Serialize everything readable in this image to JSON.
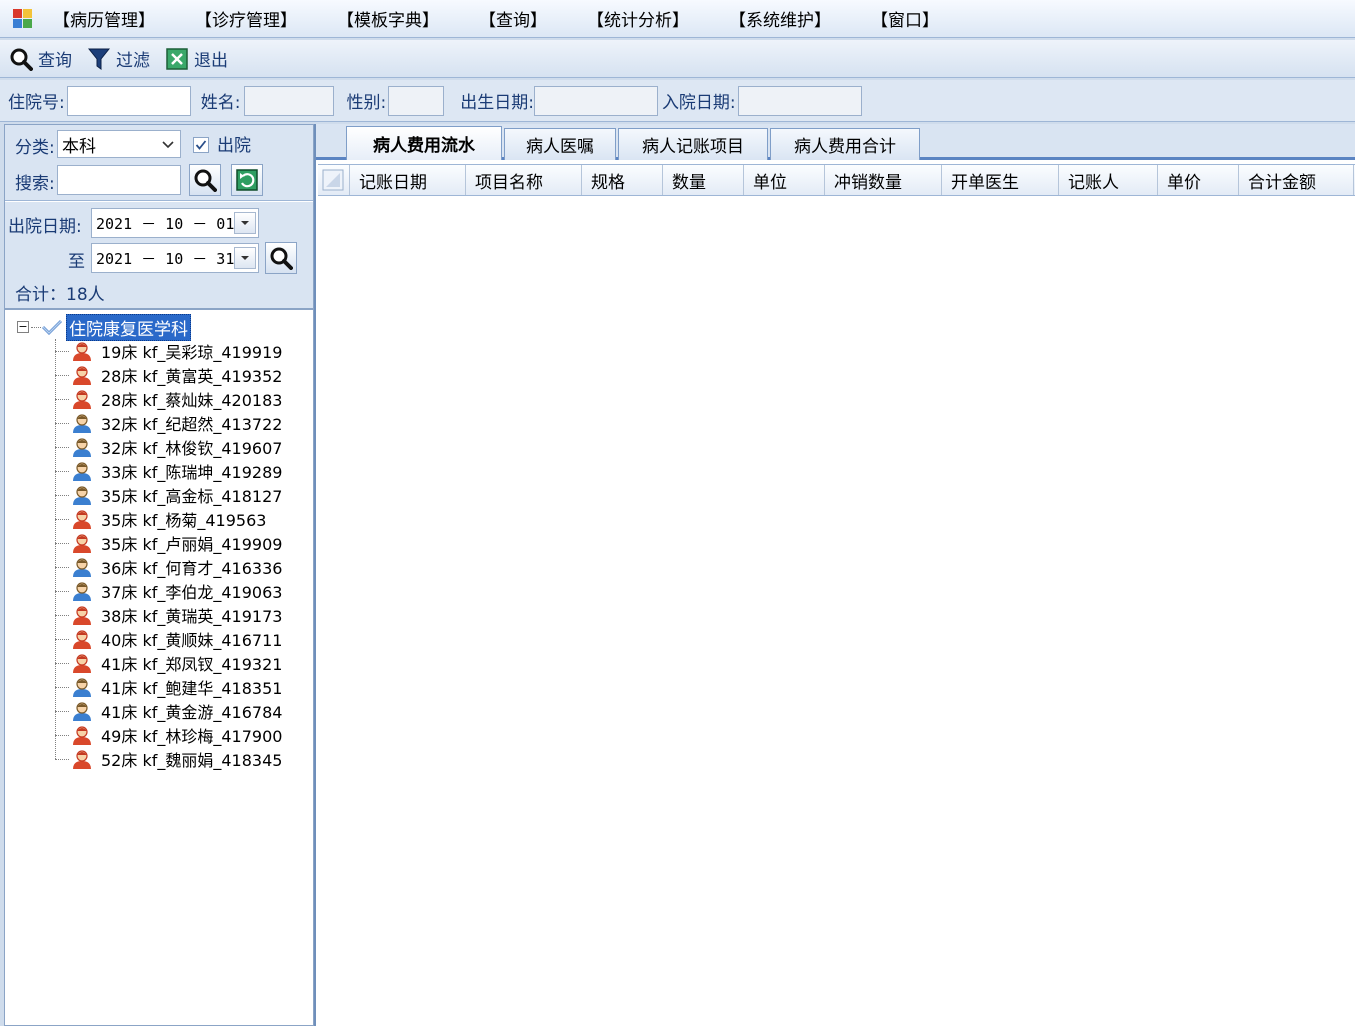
{
  "menu": {
    "items": [
      "【病历管理】",
      "【诊疗管理】",
      "【模板字典】",
      "【查询】",
      "【统计分析】",
      "【系统维护】",
      "【窗口】"
    ]
  },
  "toolbar": {
    "query_label": "查询",
    "filter_label": "过滤",
    "exit_label": "退出"
  },
  "search": {
    "admission_no_label": "住院号:",
    "name_label": "姓名:",
    "gender_label": "性别:",
    "birthdate_label": "出生日期:",
    "admit_date_label": "入院日期:"
  },
  "filter": {
    "category_label": "分类:",
    "category_value": "本科",
    "discharged_label": "出院",
    "discharged_checked": true,
    "search_label": "搜索:"
  },
  "dates": {
    "discharge_label": "出院日期:",
    "from": "2021 － 10 － 01",
    "to_label": "至",
    "to": "2021 － 10 － 31",
    "total": "合计：18人"
  },
  "tree": {
    "root": "住院康复医学科",
    "patients": [
      {
        "label": "19床 kf_吴彩琼_419919",
        "gender": "F"
      },
      {
        "label": "28床 kf_黄富英_419352",
        "gender": "F"
      },
      {
        "label": "28床 kf_蔡灿妹_420183",
        "gender": "F"
      },
      {
        "label": "32床 kf_纪超然_413722",
        "gender": "M"
      },
      {
        "label": "32床 kf_林俊钦_419607",
        "gender": "M"
      },
      {
        "label": "33床 kf_陈瑞坤_419289",
        "gender": "M"
      },
      {
        "label": "35床 kf_高金标_418127",
        "gender": "M"
      },
      {
        "label": "35床 kf_杨菊_419563",
        "gender": "F"
      },
      {
        "label": "35床 kf_卢丽娟_419909",
        "gender": "F"
      },
      {
        "label": "36床 kf_何育才_416336",
        "gender": "M"
      },
      {
        "label": "37床 kf_李伯龙_419063",
        "gender": "M"
      },
      {
        "label": "38床 kf_黄瑞英_419173",
        "gender": "F"
      },
      {
        "label": "40床 kf_黄顺妹_416711",
        "gender": "F"
      },
      {
        "label": "41床 kf_郑凤钗_419321",
        "gender": "F"
      },
      {
        "label": "41床 kf_鲍建华_418351",
        "gender": "M"
      },
      {
        "label": "41床 kf_黄金游_416784",
        "gender": "M"
      },
      {
        "label": "49床 kf_林珍梅_417900",
        "gender": "F"
      },
      {
        "label": "52床 kf_魏丽娟_418345",
        "gender": "F"
      }
    ]
  },
  "tabs": [
    "病人费用流水",
    "病人医嘱",
    "病人记账项目",
    "病人费用合计"
  ],
  "grid": {
    "columns": [
      "记账日期",
      "项目名称",
      "规格",
      "数量",
      "单位",
      "冲销数量",
      "开单医生",
      "记账人",
      "单价",
      "合计金额"
    ]
  },
  "colors": {
    "accent": "#2a69c9",
    "female_icon": "#d9482b",
    "male_icon": "#3b7fd0"
  }
}
